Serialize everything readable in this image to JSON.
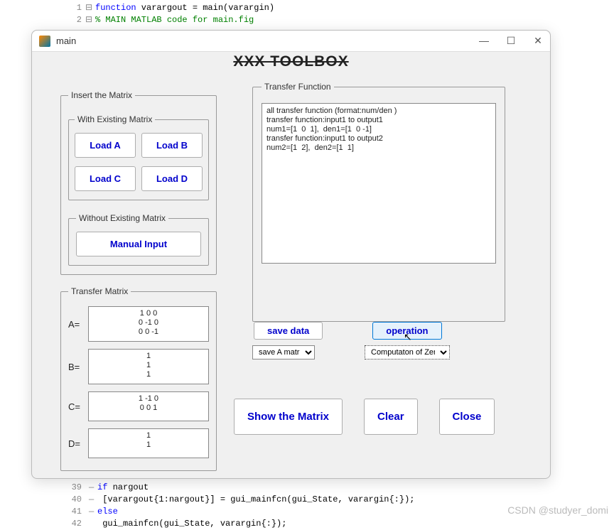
{
  "editor": {
    "lines_top": [
      {
        "n": "1",
        "fold": "⊟",
        "html": "<span class='kw'>function</span> varargout = main(varargin)"
      },
      {
        "n": "2",
        "fold": "⊟",
        "html": "<span class='com'>% MAIN MATLAB code for main.fig</span>"
      }
    ],
    "lines_bottom": [
      {
        "n": "39",
        "br": "—",
        "html": "<span class='kw'>if</span> nargout"
      },
      {
        "n": "40",
        "br": "—",
        "html": "    [varargout{1:nargout}] = gui_mainfcn(gui_State, varargin{:});"
      },
      {
        "n": "41",
        "br": "—",
        "html": "<span class='kw'>else</span>"
      },
      {
        "n": "42",
        "br": "",
        "html": "    gui_mainfcn(gui_State, varargin{:});"
      }
    ]
  },
  "dialog": {
    "title": "main",
    "toolbox_title": "XXX TOOLBOX"
  },
  "insert": {
    "legend": "Insert the Matrix",
    "with_legend": "With Existing Matrix",
    "without_legend": "Without Existing Matrix",
    "load_a": "Load A",
    "load_b": "Load B",
    "load_c": "Load C",
    "load_d": "Load D",
    "manual": "Manual Input"
  },
  "transfer_matrix": {
    "legend": "Transfer Matrix",
    "rows": [
      {
        "label": "A=",
        "text": "1 0 0\n0 -1 0\n0 0 -1"
      },
      {
        "label": "B=",
        "text": "1\n1\n1"
      },
      {
        "label": "C=",
        "text": "1 -1 0\n0 0 1"
      },
      {
        "label": "D=",
        "text": "1\n1"
      }
    ]
  },
  "transfer_function": {
    "legend": "Transfer Function",
    "text": "all transfer function (format:num/den )\ntransfer function:input1 to output1\nnum1=[1  0  1],  den1=[1  0 -1]\ntransfer function:input1 to output2\nnum2=[1  2],  den2=[1  1]"
  },
  "mid": {
    "save_data": "save data",
    "operation": "operation",
    "save_select": "save A matrix",
    "op_select": "Computaton of Zeros"
  },
  "bottom": {
    "show": "Show the Matrix",
    "clear": "Clear",
    "close": "Close"
  },
  "watermark": "CSDN @studyer_domi"
}
